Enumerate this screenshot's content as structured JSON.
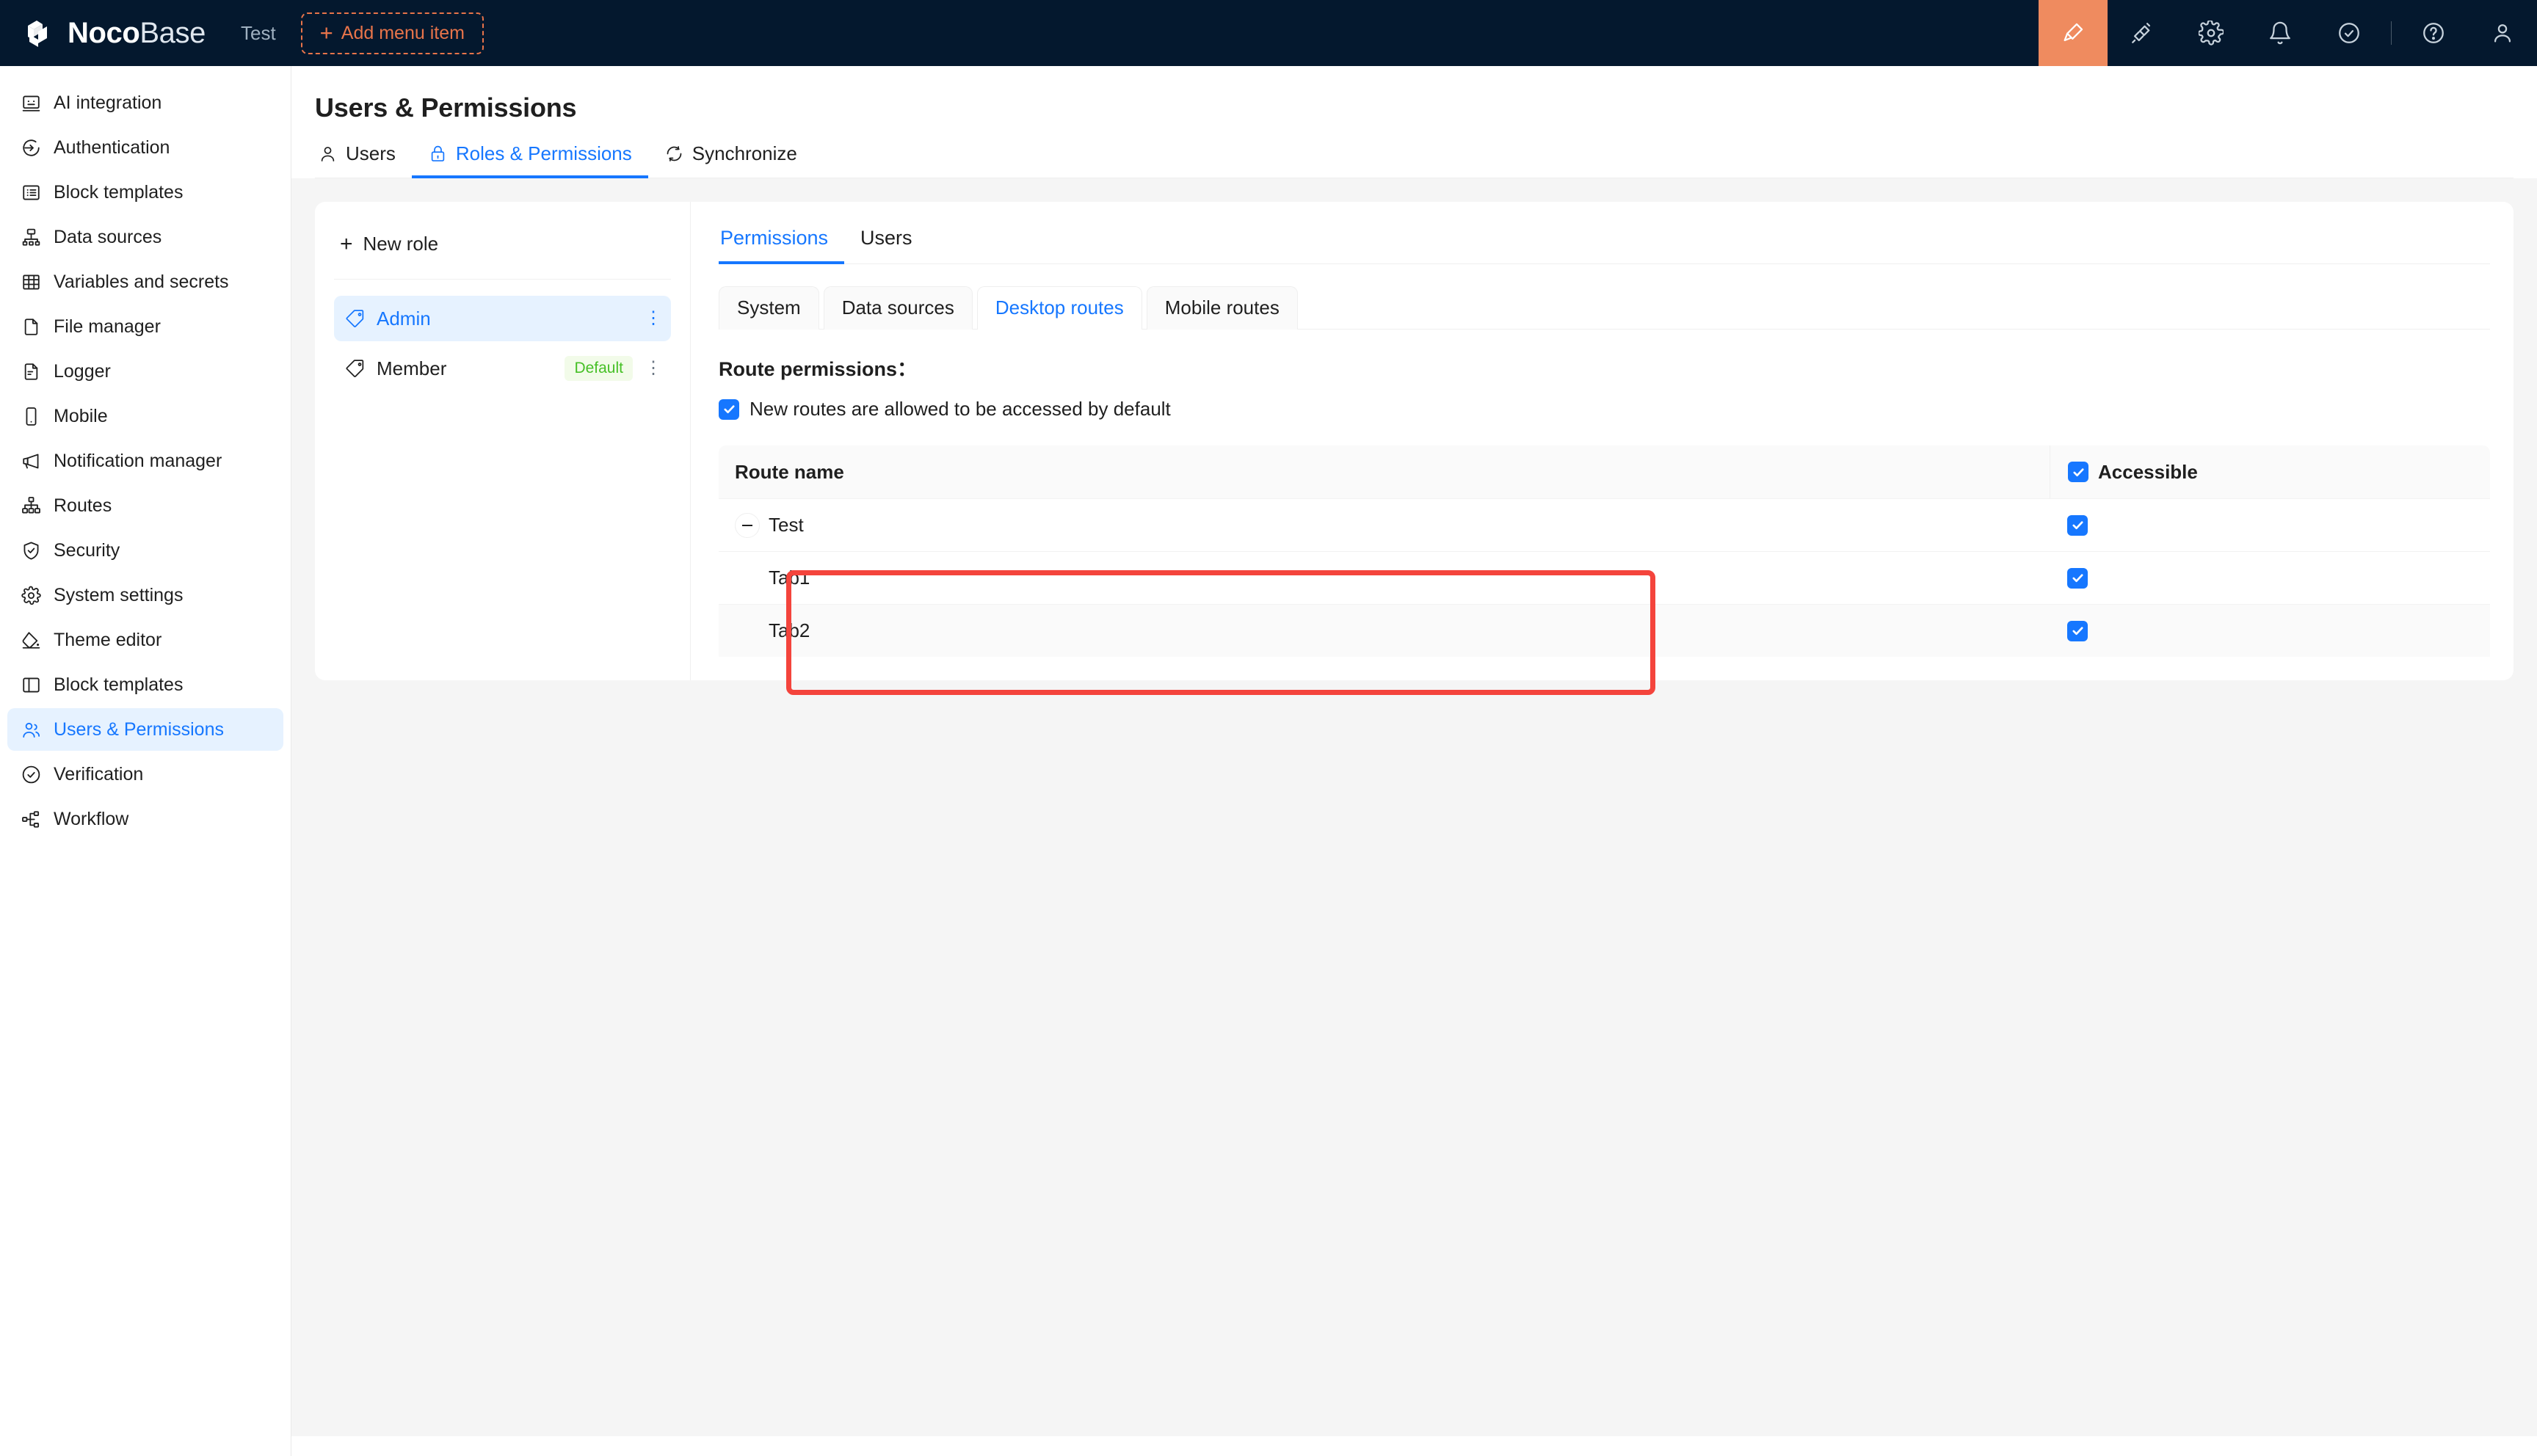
{
  "topbar": {
    "brand_noco": "Noco",
    "brand_base": "Base",
    "menu_label": "Test",
    "add_menu_item": "Add menu item",
    "plus": "+",
    "icons": [
      {
        "name": "highlighter-icon",
        "active": true
      },
      {
        "name": "plugin-icon",
        "active": false
      },
      {
        "name": "gear-icon",
        "active": false
      },
      {
        "name": "bell-icon",
        "active": false
      },
      {
        "name": "check-circle-icon",
        "active": false
      },
      {
        "name": "help-circle-icon",
        "active": false
      },
      {
        "name": "user-avatar-icon",
        "active": false
      }
    ]
  },
  "sidebar": {
    "items": [
      {
        "label": "AI integration",
        "icon": "robot-icon",
        "active": false
      },
      {
        "label": "Authentication",
        "icon": "login-arrow-icon",
        "active": false
      },
      {
        "label": "Block templates",
        "icon": "list-box-icon",
        "active": false
      },
      {
        "label": "Data sources",
        "icon": "database-tree-icon",
        "active": false
      },
      {
        "label": "Variables and secrets",
        "icon": "table-grid-icon",
        "active": false
      },
      {
        "label": "File manager",
        "icon": "file-icon",
        "active": false
      },
      {
        "label": "Logger",
        "icon": "file-lines-icon",
        "active": false
      },
      {
        "label": "Mobile",
        "icon": "mobile-icon",
        "active": false
      },
      {
        "label": "Notification manager",
        "icon": "megaphone-icon",
        "active": false
      },
      {
        "label": "Routes",
        "icon": "sitemap-icon",
        "active": false
      },
      {
        "label": "Security",
        "icon": "shield-check-icon",
        "active": false
      },
      {
        "label": "System settings",
        "icon": "gear-icon",
        "active": false
      },
      {
        "label": "Theme editor",
        "icon": "paint-bucket-icon",
        "active": false
      },
      {
        "label": "Block templates",
        "icon": "layout-panel-icon",
        "active": false
      },
      {
        "label": "Users & Permissions",
        "icon": "users-icon",
        "active": true
      },
      {
        "label": "Verification",
        "icon": "check-circle-icon",
        "active": false
      },
      {
        "label": "Workflow",
        "icon": "workflow-icon",
        "active": false
      }
    ]
  },
  "page": {
    "title": "Users & Permissions",
    "head_tabs": [
      {
        "label": "Users",
        "icon": "user-icon",
        "active": false
      },
      {
        "label": "Roles & Permissions",
        "icon": "lock-icon",
        "active": true
      },
      {
        "label": "Synchronize",
        "icon": "sync-icon",
        "active": false
      }
    ]
  },
  "roles": {
    "new_role_label": "New role",
    "plus": "+",
    "items": [
      {
        "name": "Admin",
        "badge": "",
        "active": true
      },
      {
        "name": "Member",
        "badge": "Default",
        "active": false
      }
    ]
  },
  "permissions": {
    "tabs": [
      {
        "label": "Permissions",
        "active": true
      },
      {
        "label": "Users",
        "active": false
      }
    ],
    "card_tabs": [
      {
        "label": "System",
        "active": false
      },
      {
        "label": "Data sources",
        "active": false
      },
      {
        "label": "Desktop routes",
        "active": true
      },
      {
        "label": "Mobile routes",
        "active": false
      }
    ],
    "route_permissions_title": "Route permissions：",
    "default_checkbox_label": "New routes are allowed to be accessed by default",
    "default_checkbox_checked": true,
    "table": {
      "columns": [
        {
          "label": "Route name"
        },
        {
          "label": "Accessible",
          "has_checkbox": true,
          "checked": true
        }
      ],
      "rows": [
        {
          "name": "Test",
          "indent": false,
          "expandable": true,
          "expanded": true,
          "accessible": true,
          "alt": false
        },
        {
          "name": "Tab1",
          "indent": true,
          "expandable": false,
          "expanded": false,
          "accessible": true,
          "alt": false
        },
        {
          "name": "Tab2",
          "indent": true,
          "expandable": false,
          "expanded": false,
          "accessible": true,
          "alt": true
        }
      ]
    }
  },
  "annotation": {
    "highlight_color": "#f4443c"
  },
  "colors": {
    "topbar_bg": "#04182e",
    "accent_blue": "#1677ff",
    "accent_orange": "#e8744a",
    "badge_green": "#46c026",
    "page_bg": "#f5f5f5"
  }
}
